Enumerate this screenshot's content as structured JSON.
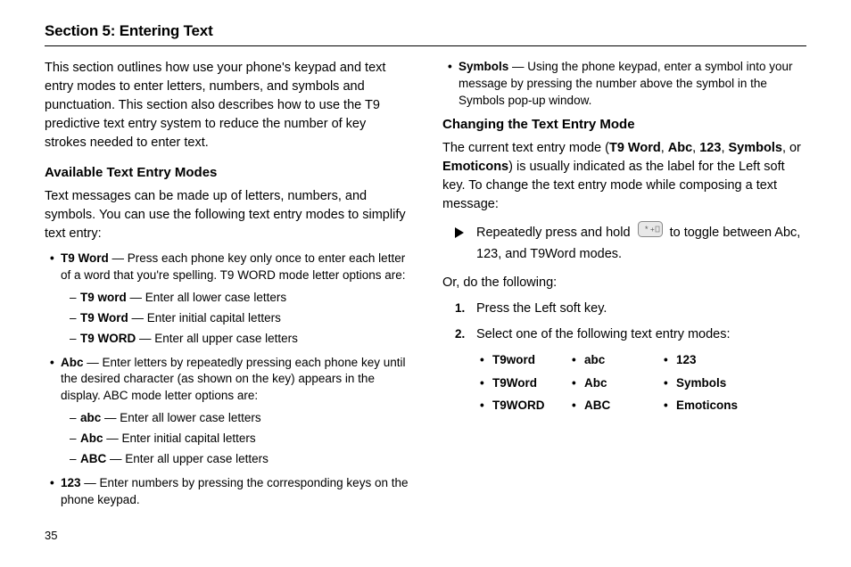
{
  "page_number": "35",
  "section_title": "Section 5: Entering Text",
  "left": {
    "intro": "This section outlines how use your phone's keypad and text entry modes to enter letters, numbers, and symbols and punctuation. This section also describes how to use the T9 predictive text entry system to reduce the number of key strokes needed to enter text.",
    "subheading": "Available Text Entry Modes",
    "lead": "Text messages can be made up of letters, numbers, and symbols. You can use the following text entry modes to simplify text entry:",
    "t9": {
      "label": "T9 Word",
      "desc": " — Press each phone key only once to enter each letter of a word that you're spelling. T9 WORD mode letter options are:",
      "sub": [
        {
          "label": "T9 word",
          "desc": " — Enter all lower case letters"
        },
        {
          "label": "T9 Word",
          "desc": " — Enter initial capital letters"
        },
        {
          "label": "T9 WORD",
          "desc": " — Enter all upper case letters"
        }
      ]
    },
    "abc": {
      "label": "Abc",
      "desc": " — Enter letters by repeatedly pressing each phone key until the desired character (as shown on the key) appears in the display. ABC mode letter options are:",
      "sub": [
        {
          "label": "abc",
          "desc": " — Enter all lower case letters"
        },
        {
          "label": "Abc",
          "desc": " — Enter initial capital letters"
        },
        {
          "label": "ABC",
          "desc": " — Enter all upper case letters"
        }
      ]
    },
    "n123": {
      "label": "123",
      "desc": " — Enter numbers by pressing the corresponding keys on the phone keypad."
    }
  },
  "right": {
    "symbols": {
      "label": "Symbols",
      "desc": " — Using the phone keypad, enter a symbol into your message by pressing the number above the symbol in the Symbols pop-up window."
    },
    "subheading": "Changing the Text Entry Mode",
    "lead_pre": "The current text entry mode (",
    "lead_modes": [
      "T9 Word",
      "Abc",
      "123",
      "Symbols",
      "Emoticons"
    ],
    "lead_post": ") is usually indicated as the label for the Left soft key. To change the text entry mode while composing a text message:",
    "toggle_pre": "Repeatedly press and hold ",
    "toggle_post": " to toggle between Abc, 123, and T9Word modes.",
    "or_text": "Or, do the following:",
    "step1": "Press the Left soft key.",
    "step2": "Select one of the following text entry modes:",
    "modes_grid": [
      "T9word",
      "abc",
      "123",
      "T9Word",
      "Abc",
      "Symbols",
      "T9WORD",
      "ABC",
      "Emoticons"
    ]
  }
}
